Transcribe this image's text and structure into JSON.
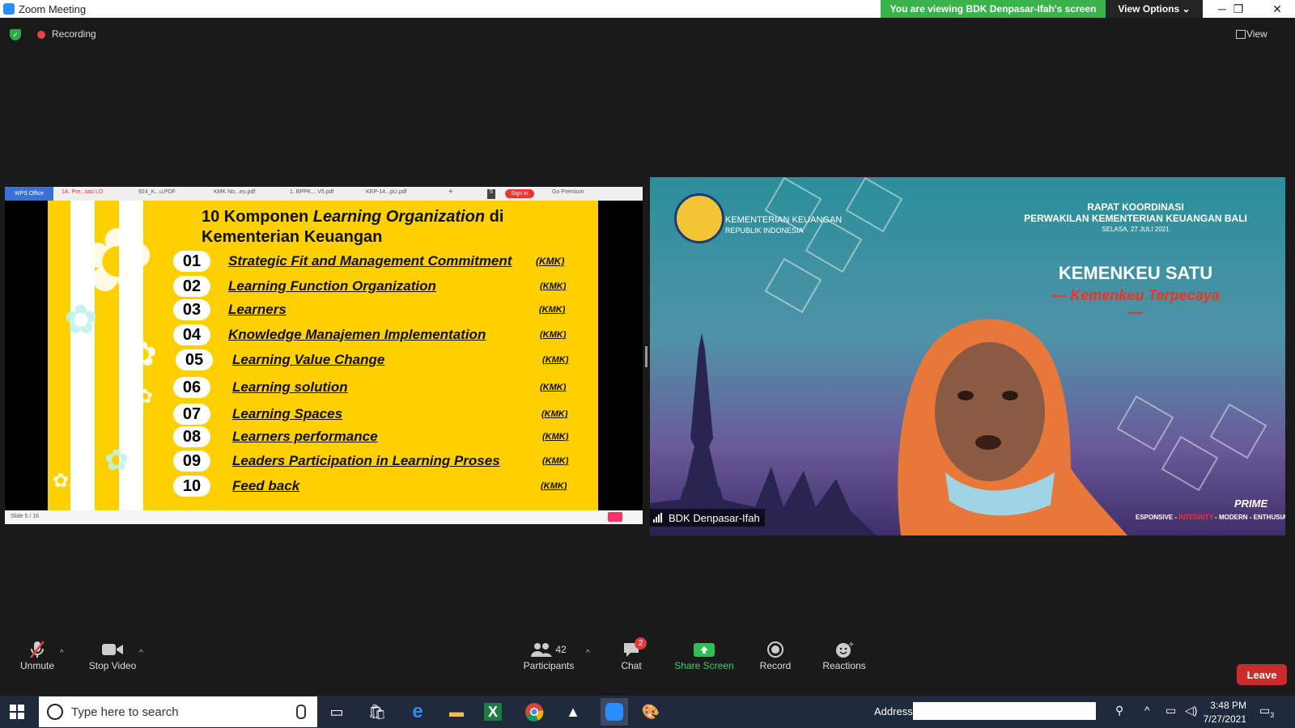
{
  "window": {
    "title": "Zoom Meeting",
    "banner": "You are viewing BDK Denpasar-Ifah's screen",
    "view_options": "View Options",
    "minimize": "─",
    "restore": "❐",
    "close": "✕"
  },
  "topbar": {
    "recording": "Recording",
    "view": "View"
  },
  "shared_screen": {
    "app": "WPS Office",
    "tabs": [
      "1A. Pre...tasi LO",
      "924_K...u.PDF",
      "KMK No...eu.pdf",
      "1. BPPK... V5.pdf",
      "KEP-14...pU.pdf"
    ],
    "tab_add": "+",
    "tab_count": "5",
    "sign_in": "Sign in",
    "premium": "Go Premium",
    "slide_counter": "Slide 5 / 16",
    "slide": {
      "title_plain_1": "10 Komponen ",
      "title_italic": "Learning Organization",
      "title_plain_2": " di",
      "title_line2": "Kementerian Keuangan",
      "items": [
        {
          "num": "01",
          "label": "Strategic Fit and Management Commitment",
          "tag": "(KMK)"
        },
        {
          "num": "02",
          "label": "Learning Function Organization",
          "tag": "(KMK)"
        },
        {
          "num": "03",
          "label": "Learners",
          "tag": "(KMK)"
        },
        {
          "num": "04",
          "label": "Knowledge Manajemen Implementation",
          "tag": "(KMK)"
        },
        {
          "num": "05",
          "label": "Learning Value Change",
          "tag": "(KMK)"
        },
        {
          "num": "06",
          "label": "Learning solution",
          "tag": "(KMK)"
        },
        {
          "num": "07",
          "label": "Learning Spaces",
          "tag": "(KMK)"
        },
        {
          "num": "08",
          "label": "Learners performance",
          "tag": "(KMK)"
        },
        {
          "num": "09",
          "label": "Leaders Participation in Learning Proses",
          "tag": "(KMK)"
        },
        {
          "num": "10",
          "label": "Feed back",
          "tag": "(KMK)"
        }
      ]
    }
  },
  "video": {
    "org": "KEMENTERIAN KEUANGAN",
    "org_sub": "REPUBLIK INDONESIA",
    "event_1": "RAPAT KOORDINASI",
    "event_2": "PERWAKILAN KEMENTERIAN KEUANGAN BALI",
    "event_date": "SELASA, 27 JULI 2021",
    "motto": "KEMENKEU SATU",
    "motto_sub": "— Kemenkeu Terpecaya —",
    "prime": "PRIME",
    "tagline_1": "ESPONSIVE - ",
    "tagline_red": "INTEGRITY",
    "tagline_2": " - MODERN - ENTHUSIASTIC",
    "participant_name": "BDK Denpasar-Ifah"
  },
  "toolbar": {
    "unmute": "Unmute",
    "stop_video": "Stop Video",
    "participants": "Participants",
    "participants_count": "42",
    "chat": "Chat",
    "chat_badge": "2",
    "share_screen": "Share Screen",
    "record": "Record",
    "reactions": "Reactions",
    "leave": "Leave"
  },
  "taskbar": {
    "search_placeholder": "Type here to search",
    "address_label": "Address",
    "time": "3:48 PM",
    "date": "7/27/2021",
    "notifications": "3"
  },
  "colors": {
    "share_green": "#3bb24a",
    "leave_red": "#cc2b2b",
    "slide_yellow": "#ffd000",
    "zoom_blue": "#2d8cff"
  }
}
